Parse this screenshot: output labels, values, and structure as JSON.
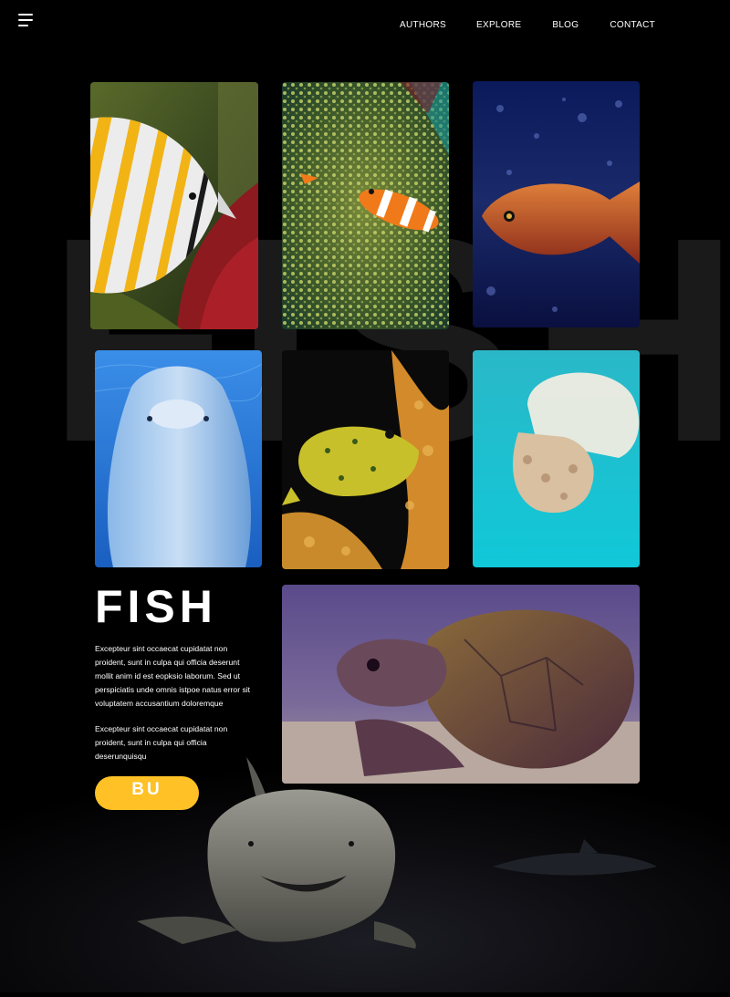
{
  "nav": {
    "items": [
      "AUTHORS",
      "EXPLORE",
      "BLOG",
      "CONTACT"
    ]
  },
  "background_word": "FISH",
  "gallery": {
    "images": [
      {
        "subject": "butterflyfish-image"
      },
      {
        "subject": "clownfish-anemone-image"
      },
      {
        "subject": "red-fish-image"
      },
      {
        "subject": "dolphin-image"
      },
      {
        "subject": "boxfish-image"
      },
      {
        "subject": "jellyfish-image"
      },
      {
        "subject": "sea-turtle-image"
      }
    ]
  },
  "info": {
    "title": "FISH",
    "paragraph1": "Excepteur sint occaecat cupidatat non proident, sunt in culpa qui officia deserunt mollit anim id est eopksio laborum. Sed ut perspiciatis unde omnis istpoe natus error sit voluptatem accusantium doloremque",
    "paragraph2": "Excepteur sint occaecat cupidatat non proident, sunt in culpa qui officia deserunquisqu",
    "button_label": "BU"
  },
  "colors": {
    "background": "#000000",
    "accent": "#ffc125"
  }
}
